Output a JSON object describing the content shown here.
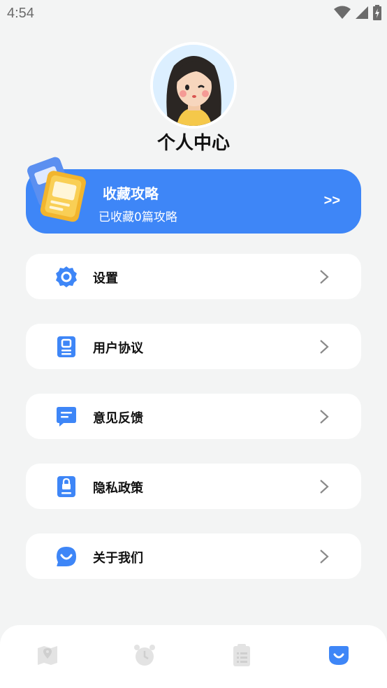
{
  "status_bar": {
    "time": "4:54",
    "icons": [
      "wifi-icon",
      "signal-icon",
      "battery-charging-icon"
    ]
  },
  "profile": {
    "avatar": "girl-avatar",
    "title": "个人中心"
  },
  "favorites_card": {
    "title": "收藏攻略",
    "subtitle": "已收藏0篇攻略",
    "arrow": ">>",
    "icon": "folder-docs-icon",
    "color": "#3e86f7"
  },
  "menu": [
    {
      "label": "设置",
      "icon": "settings-gear-icon"
    },
    {
      "label": "用户协议",
      "icon": "agreement-doc-icon"
    },
    {
      "label": "意见反馈",
      "icon": "feedback-chat-icon"
    },
    {
      "label": "隐私政策",
      "icon": "privacy-lock-icon"
    },
    {
      "label": "关于我们",
      "icon": "about-smile-icon"
    }
  ],
  "bottom_nav": {
    "tabs": [
      {
        "icon": "map-pin-icon",
        "active": false
      },
      {
        "icon": "alarm-clock-icon",
        "active": false
      },
      {
        "icon": "clipboard-list-icon",
        "active": false
      },
      {
        "icon": "profile-tab-icon",
        "active": true
      }
    ],
    "active_color": "#3e86f7",
    "inactive_color": "#e3e3e3"
  }
}
